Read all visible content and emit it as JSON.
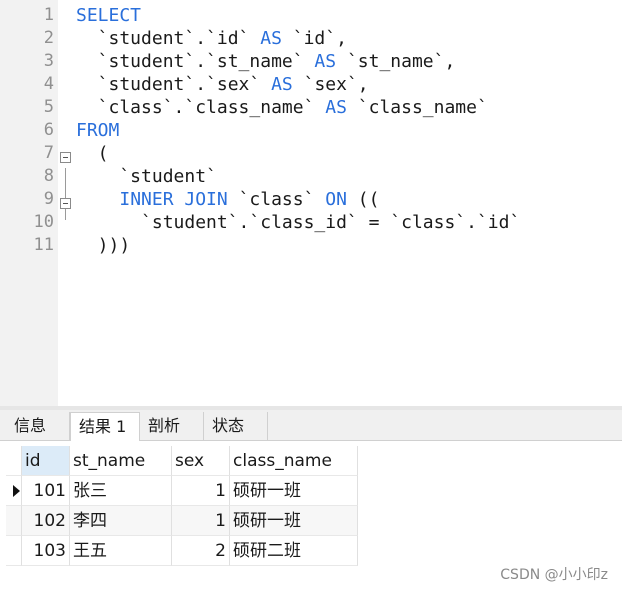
{
  "editor": {
    "line_numbers": [
      "1",
      "2",
      "3",
      "4",
      "5",
      "6",
      "7",
      "8",
      "9",
      "10",
      "11"
    ],
    "lines": [
      [
        {
          "t": "SELECT",
          "k": true
        }
      ],
      [
        {
          "t": "  `student`.`id` ",
          "k": false
        },
        {
          "t": "AS",
          "k": true
        },
        {
          "t": " `id`,",
          "k": false
        }
      ],
      [
        {
          "t": "  `student`.`st_name` ",
          "k": false
        },
        {
          "t": "AS",
          "k": true
        },
        {
          "t": " `st_name`,",
          "k": false
        }
      ],
      [
        {
          "t": "  `student`.`sex` ",
          "k": false
        },
        {
          "t": "AS",
          "k": true
        },
        {
          "t": " `sex`,",
          "k": false
        }
      ],
      [
        {
          "t": "  `class`.`class_name` ",
          "k": false
        },
        {
          "t": "AS",
          "k": true
        },
        {
          "t": " `class_name`",
          "k": false
        }
      ],
      [
        {
          "t": "FROM",
          "k": true
        }
      ],
      [
        {
          "t": "  (",
          "k": false
        }
      ],
      [
        {
          "t": "    `student`",
          "k": false
        }
      ],
      [
        {
          "t": "    ",
          "k": false
        },
        {
          "t": "INNER JOIN",
          "k": true
        },
        {
          "t": " `class` ",
          "k": false
        },
        {
          "t": "ON",
          "k": true
        },
        {
          "t": " ((",
          "k": false
        }
      ],
      [
        {
          "t": "      `student`.`class_id` = `class`.`id`",
          "k": false
        }
      ],
      [
        {
          "t": "  )))",
          "k": false
        }
      ]
    ],
    "keyword_color": "#2a6fdb"
  },
  "result": {
    "tabs": [
      {
        "label": "信息",
        "active": false
      },
      {
        "label": "结果 1",
        "active": true
      },
      {
        "label": "剖析",
        "active": false
      },
      {
        "label": "状态",
        "active": false
      }
    ],
    "columns": [
      "id",
      "st_name",
      "sex",
      "class_name"
    ],
    "rows": [
      [
        "101",
        "张三",
        "1",
        "硕研一班"
      ],
      [
        "102",
        "李四",
        "1",
        "硕研一班"
      ],
      [
        "103",
        "王五",
        "2",
        "硕研二班"
      ]
    ],
    "selected_row_index": 0
  },
  "watermark": "CSDN @小小印z"
}
